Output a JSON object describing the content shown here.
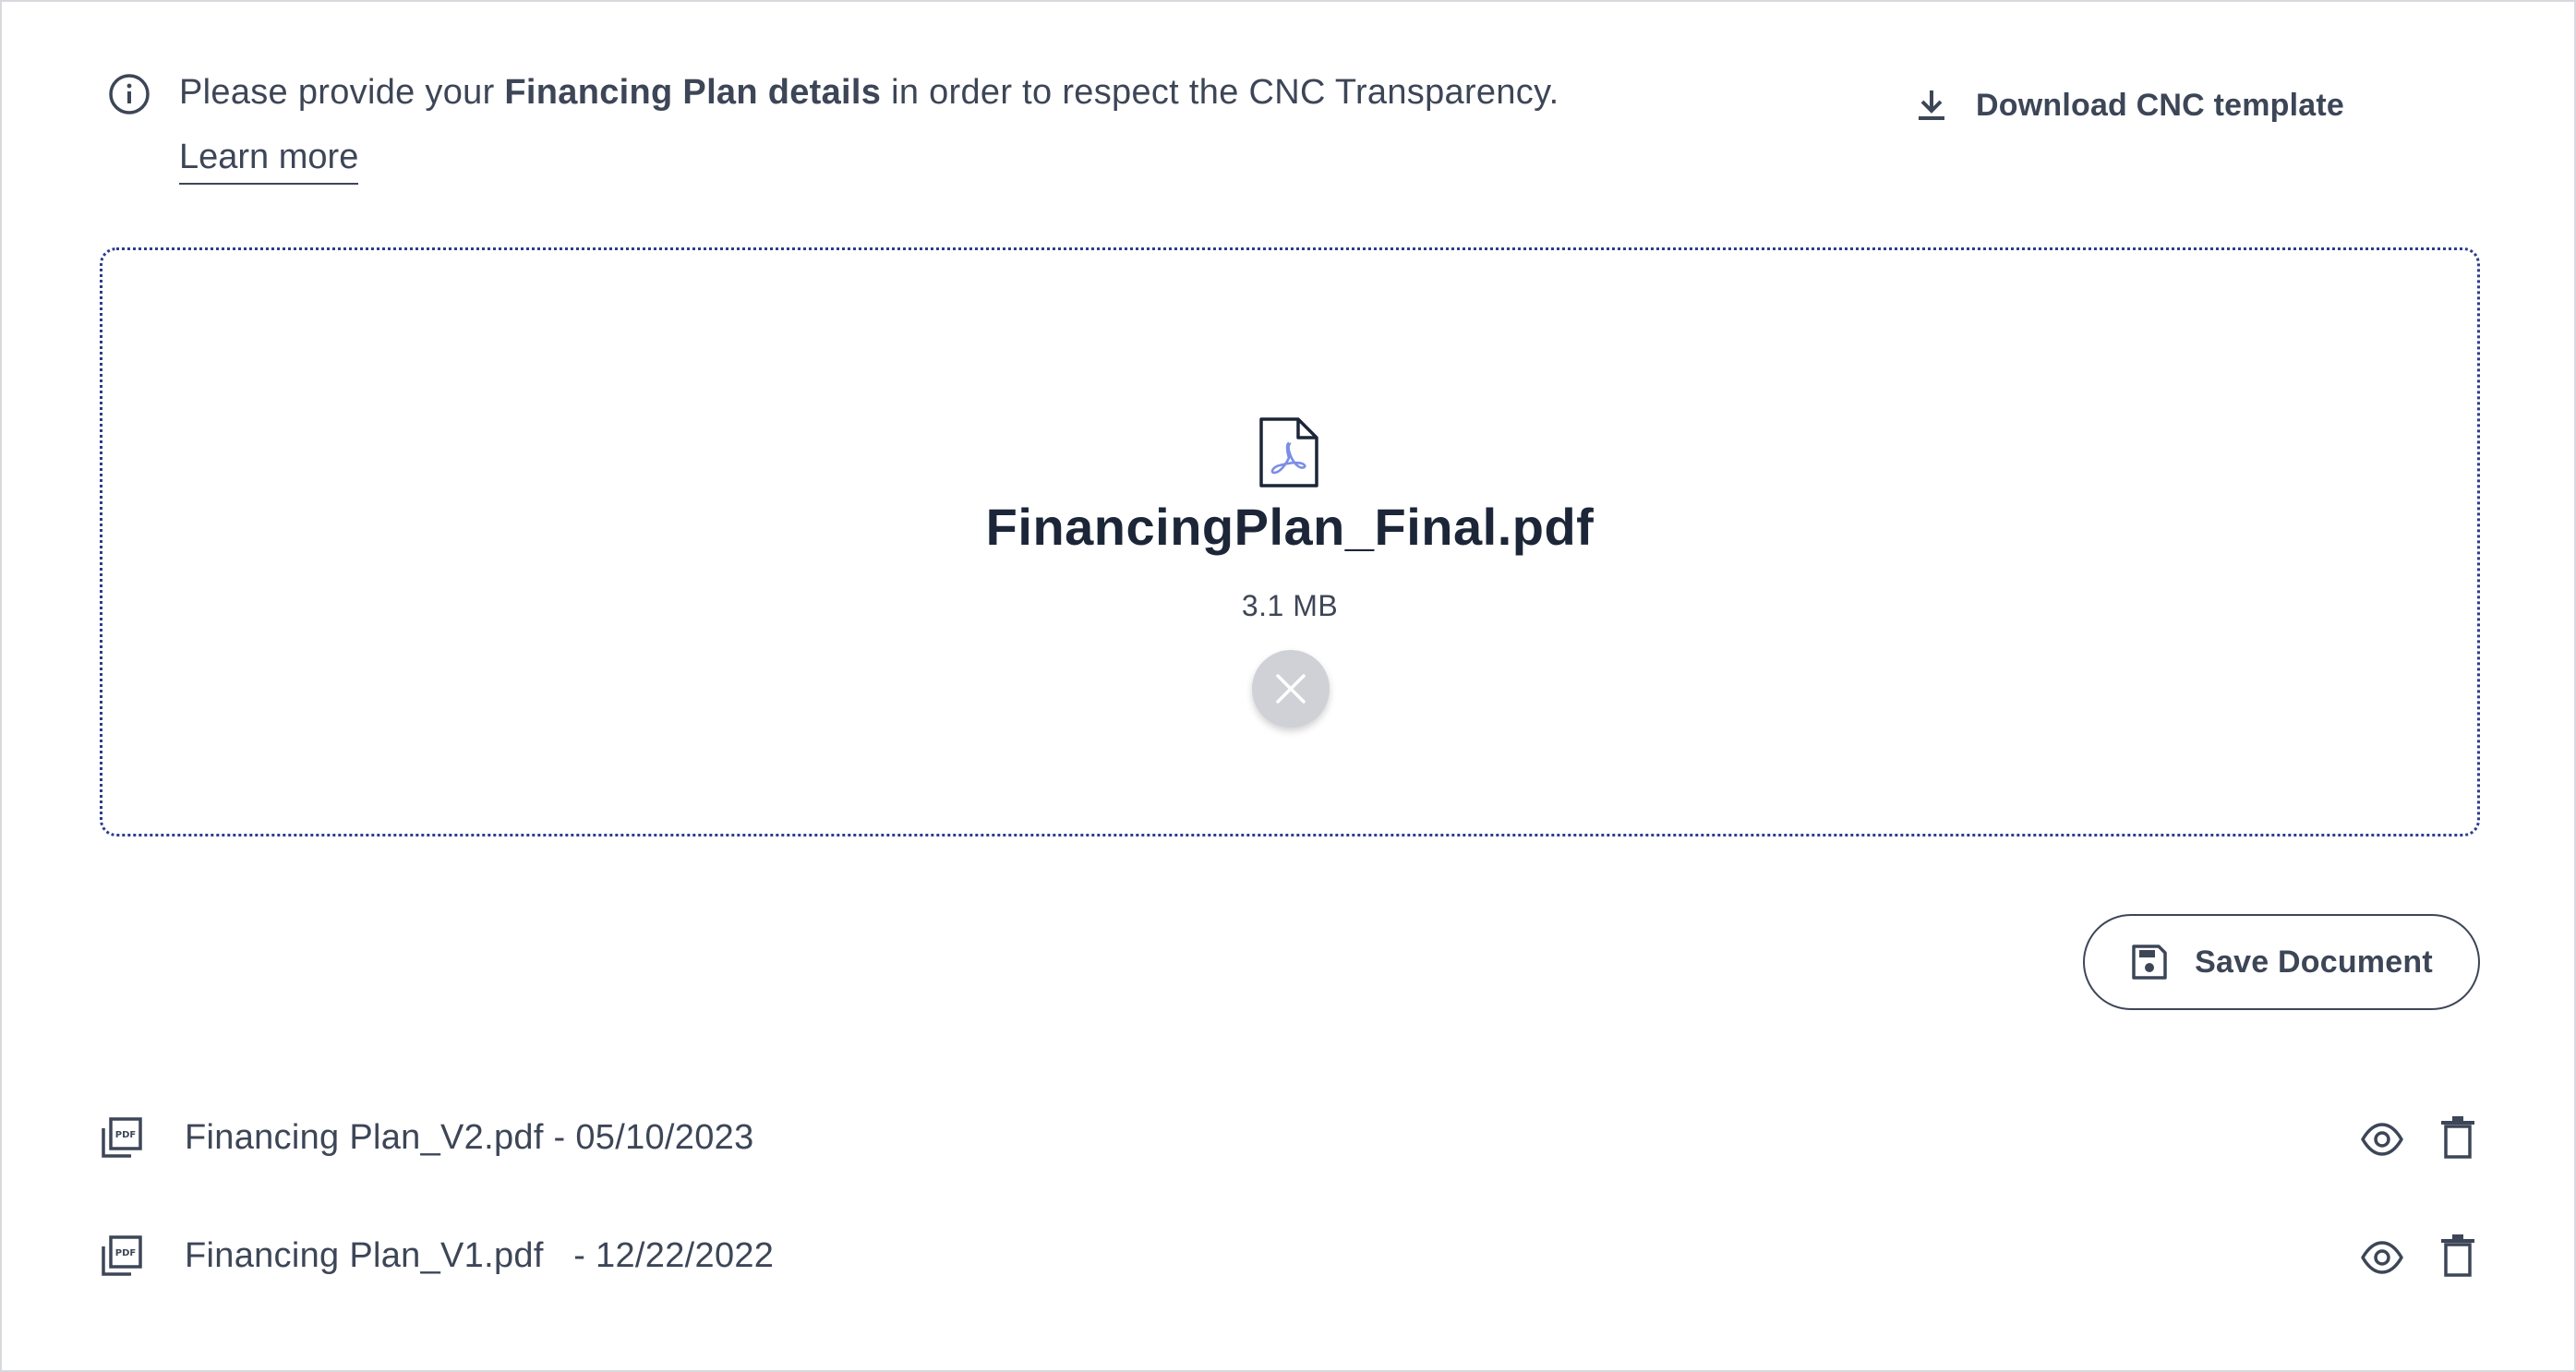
{
  "info_banner": {
    "text_before": "Please provide your ",
    "text_bold": "Financing Plan details",
    "text_after": " in order to respect the CNC Transparency.",
    "learn_more_label": "Learn more"
  },
  "download": {
    "label": "Download CNC template",
    "icon": "download-icon"
  },
  "upload": {
    "file_name": "FinancingPlan_Final.pdf",
    "file_size": "3.1 MB",
    "file_icon": "pdf-file-icon",
    "remove_icon": "close-icon"
  },
  "save_button": {
    "label": "Save Document",
    "icon": "floppy-disk-icon"
  },
  "documents": [
    {
      "label": "Financing Plan_V2.pdf - 05/10/2023"
    },
    {
      "label": "Financing Plan_V1.pdf   - 12/22/2022"
    }
  ],
  "colors": {
    "text": "#3d4657",
    "heading": "#1c2638",
    "dropzone_border": "#2c3c8c",
    "pdf_accent": "#7b8ee6",
    "remove_button_bg": "#cfd1d6"
  }
}
